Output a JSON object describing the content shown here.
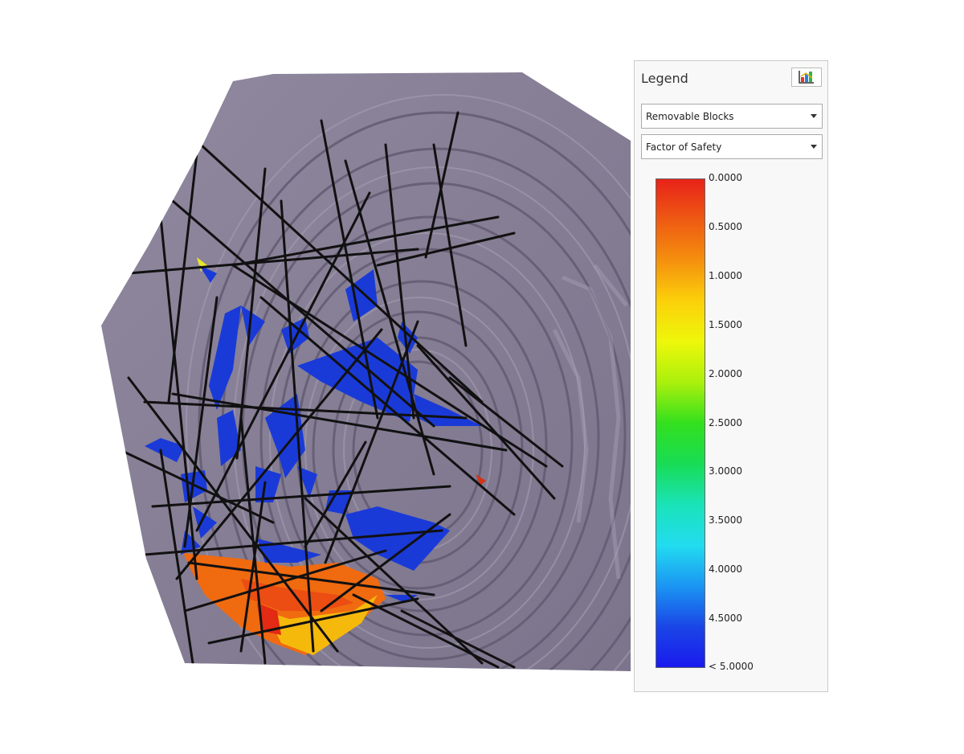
{
  "legend": {
    "title": "Legend",
    "settings_icon": "legend-chart-icon",
    "block_type_select": {
      "value": "Removable Blocks"
    },
    "result_select": {
      "value": "Factor of Safety"
    },
    "color_scale": {
      "stops": [
        "#e8221a",
        "#ee5a12",
        "#f5900e",
        "#fbd10a",
        "#eef70a",
        "#aaf00c",
        "#33e01e",
        "#18dc55",
        "#1ae3b8",
        "#22dcf0",
        "#1b96f3",
        "#1a46e6",
        "#1a1aee"
      ],
      "labels": [
        "0.0000",
        "0.5000",
        "1.0000",
        "1.5000",
        "2.0000",
        "2.5000",
        "3.0000",
        "3.5000",
        "4.0000",
        "4.5000",
        "< 5.0000"
      ]
    }
  },
  "viewport": {
    "terrain_color": "#877f96",
    "joint_color": "#111111",
    "stable_block_color": "#1a3ad8"
  }
}
